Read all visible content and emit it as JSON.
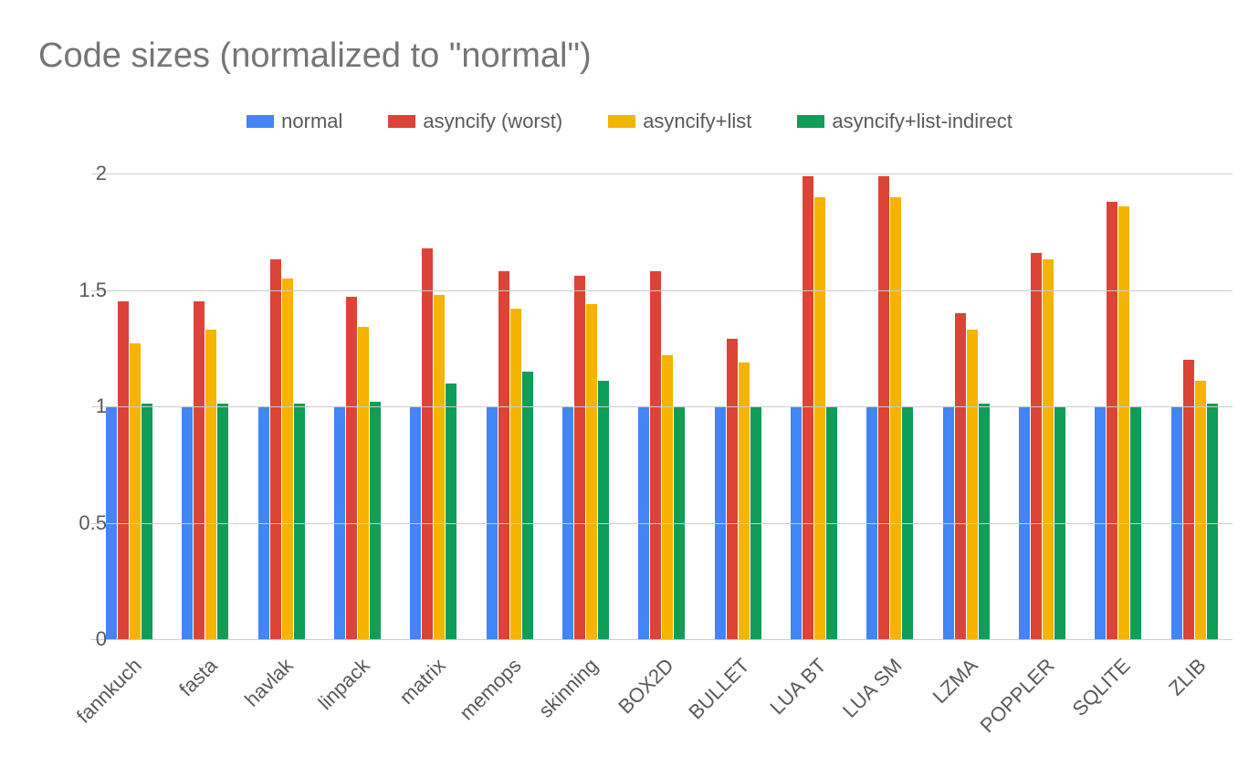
{
  "chart_data": {
    "type": "bar",
    "title": "Code sizes (normalized to \"normal\")",
    "xlabel": "",
    "ylabel": "",
    "ylim": [
      0,
      2
    ],
    "yticks": [
      0,
      0.5,
      1,
      1.5,
      2
    ],
    "categories": [
      "fannkuch",
      "fasta",
      "havlak",
      "linpack",
      "matrix",
      "memops",
      "skinning",
      "BOX2D",
      "BULLET",
      "LUA BT",
      "LUA SM",
      "LZMA",
      "POPPLER",
      "SQLITE",
      "ZLIB"
    ],
    "series": [
      {
        "name": "normal",
        "color": "#4285F4",
        "values": [
          1.0,
          1.0,
          1.0,
          1.0,
          1.0,
          1.0,
          1.0,
          1.0,
          1.0,
          1.0,
          1.0,
          1.0,
          1.0,
          1.0,
          1.0
        ]
      },
      {
        "name": "asyncify (worst)",
        "color": "#DB4437",
        "values": [
          1.45,
          1.45,
          1.63,
          1.47,
          1.68,
          1.58,
          1.56,
          1.58,
          1.29,
          1.99,
          1.99,
          1.4,
          1.66,
          1.88,
          1.2
        ]
      },
      {
        "name": "asyncify+list",
        "color": "#F4B400",
        "values": [
          1.27,
          1.33,
          1.55,
          1.34,
          1.48,
          1.42,
          1.44,
          1.22,
          1.19,
          1.9,
          1.9,
          1.33,
          1.63,
          1.86,
          1.11
        ]
      },
      {
        "name": "asyncify+list-indirect",
        "color": "#0F9D58",
        "values": [
          1.01,
          1.01,
          1.01,
          1.02,
          1.1,
          1.15,
          1.11,
          1.0,
          1.0,
          1.0,
          1.0,
          1.01,
          1.0,
          1.0,
          1.01
        ]
      }
    ]
  }
}
